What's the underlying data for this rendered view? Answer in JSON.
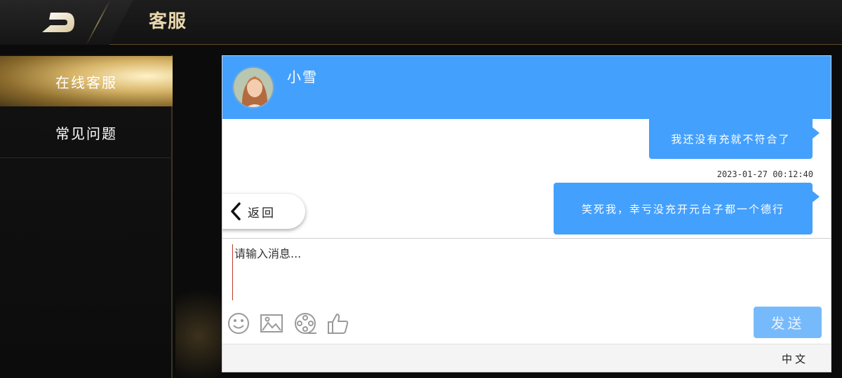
{
  "header": {
    "title": "客服",
    "back_icon": "back-arrow-icon"
  },
  "sidebar": {
    "items": [
      {
        "label": "在线客服",
        "active": true
      },
      {
        "label": "常见问题",
        "active": false
      }
    ]
  },
  "chat": {
    "agent_name": "小雪",
    "back_label": "返回",
    "messages": [
      {
        "text": "我还没有充就不符合了",
        "from": "user"
      },
      {
        "time": "2023-01-27 00:12:40"
      },
      {
        "text": "笑死我，幸亏没充开元台子都一个德行",
        "from": "user"
      }
    ],
    "input_placeholder": "请输入消息...",
    "tools": [
      "emoji-icon",
      "image-icon",
      "video-reel-icon",
      "thumbs-up-icon"
    ],
    "send_label": "发送",
    "language": "中文"
  },
  "colors": {
    "accent_blue": "#44a0fd",
    "send_disabled": "#77bafc",
    "gold": "#d8b66a",
    "title_text": "#e8d7ad"
  }
}
